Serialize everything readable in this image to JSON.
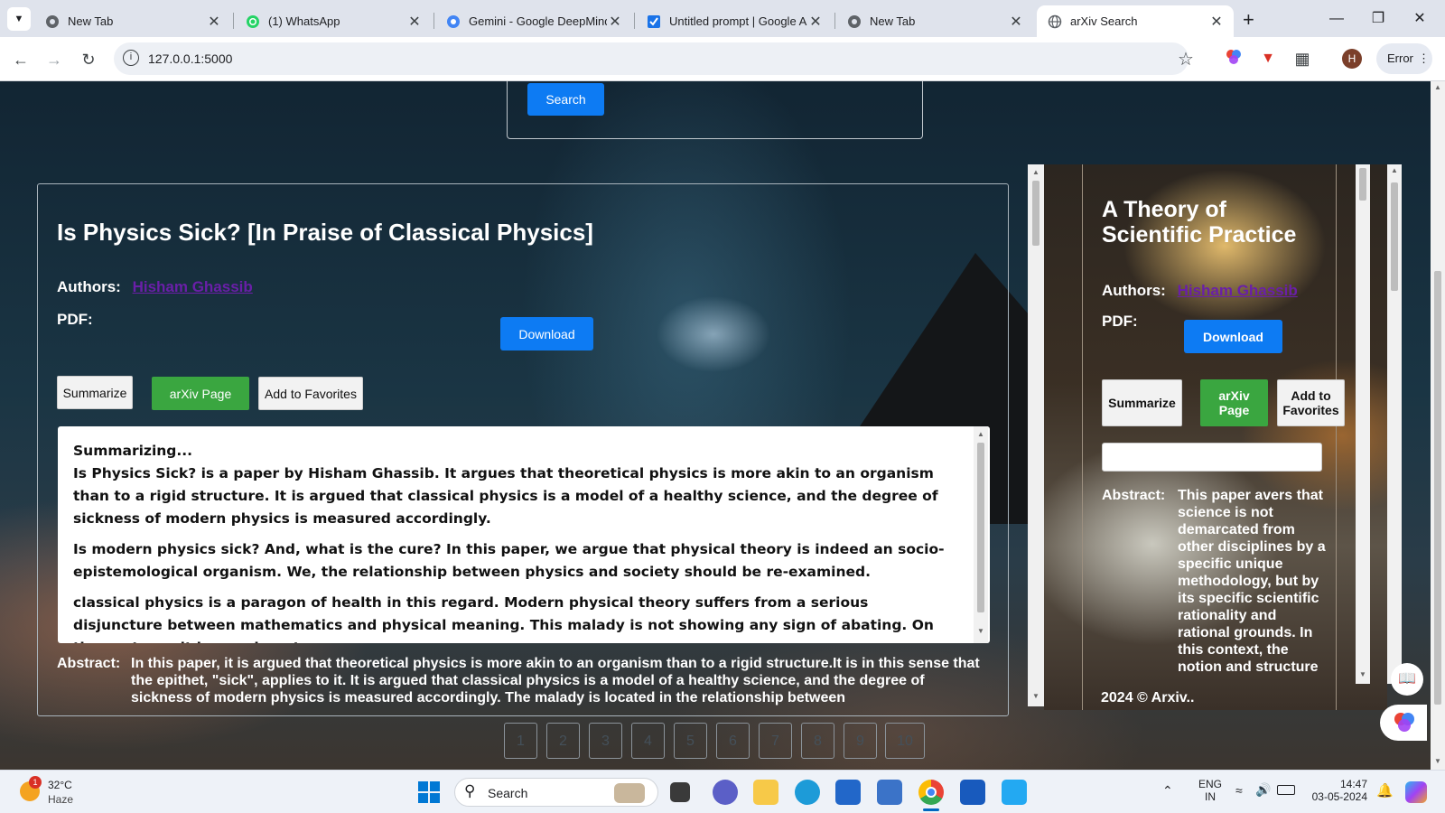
{
  "browser": {
    "tabs": [
      {
        "title": "New Tab",
        "icon": "chrome-icon",
        "color": "#5f6368"
      },
      {
        "title": "(1) WhatsApp",
        "icon": "whatsapp-icon",
        "color": "#25d366"
      },
      {
        "title": "Gemini - Google DeepMind",
        "icon": "gemini-icon",
        "color": "#4285f4"
      },
      {
        "title": "Untitled prompt | Google AI Studio",
        "icon": "ai-studio-icon",
        "color": "#1a73e8"
      },
      {
        "title": "New Tab",
        "icon": "chrome-icon",
        "color": "#5f6368"
      },
      {
        "title": "arXiv Search",
        "icon": "globe-icon",
        "color": "#5f6368",
        "active": true
      }
    ],
    "new_tab": "+",
    "url": "127.0.0.1:5000",
    "error_label": "Error",
    "profile_initial": "H"
  },
  "search": {
    "button_label": "Search"
  },
  "papers": [
    {
      "title": "Is Physics Sick? [In Praise of Classical Physics]",
      "authors_label": "Authors:",
      "authors": "Hisham Ghassib",
      "pdf_label": "PDF:",
      "download_label": "Download",
      "summarize_label": "Summarize",
      "arxiv_label": "arXiv Page",
      "favorites_label": "Add to Favorites",
      "summary": {
        "heading": "Summarizing...",
        "paragraphs": [
          "Is Physics Sick? is a paper by Hisham Ghassib. It argues that theoretical physics is more akin to an organism than to a rigid structure. It is argued that classical physics is a model of a healthy science, and the degree of sickness of modern physics is measured accordingly.",
          "Is modern physics sick? And, what is the cure? In this paper, we argue that physical theory is indeed an socio-epistemological organism. We, the relationship between physics and society should be re-examined.",
          "classical physics is a paragon of health in this regard. Modern physical theory suffers from a serious disjuncture between mathematics and physical meaning. This malady is not showing any sign of abating. On the contrary, it is growing at an"
        ]
      },
      "abstract_label": "Abstract:",
      "abstract": "In this paper, it is argued that theoretical physics is more akin to an organism than to a rigid structure.It is in this sense that the epithet, \"sick\", applies to it. It is argued that classical physics is a model of a healthy science, and the degree of sickness of modern physics is measured accordingly. The malady is located in the relationship between"
    },
    {
      "title": "A Theory of Scientific Practice",
      "authors_label": "Authors:",
      "authors": "Hisham Ghassib",
      "pdf_label": "PDF:",
      "download_label": "Download",
      "summarize_label": "Summarize",
      "arxiv_label": "arXiv Page",
      "favorites_label": "Add to Favorites",
      "abstract_label": "Abstract:",
      "abstract": "This paper avers that science is not demarcated from other disciplines by a specific unique methodology, but by its specific scientific rationality and rational grounds. In this context, the notion and structure of",
      "footer": "2024 © Arxiv.. "
    }
  ],
  "pagination": [
    "1",
    "2",
    "3",
    "4",
    "5",
    "6",
    "7",
    "8",
    "9",
    "10"
  ],
  "taskbar": {
    "weather_temp": "32°C",
    "weather_desc": "Haze",
    "weather_badge": "1",
    "search_placeholder": "Search",
    "lang_top": "ENG",
    "lang_bottom": "IN",
    "time": "14:47",
    "date": "03-05-2024",
    "apps": [
      "start",
      "search",
      "task-view",
      "teams",
      "file-explorer",
      "edge",
      "store",
      "python-idle",
      "chrome",
      "word",
      "vscode"
    ]
  },
  "colors": {
    "primary": "#0d7bf3",
    "success": "#3aa640",
    "link": "#6a1fa8"
  }
}
